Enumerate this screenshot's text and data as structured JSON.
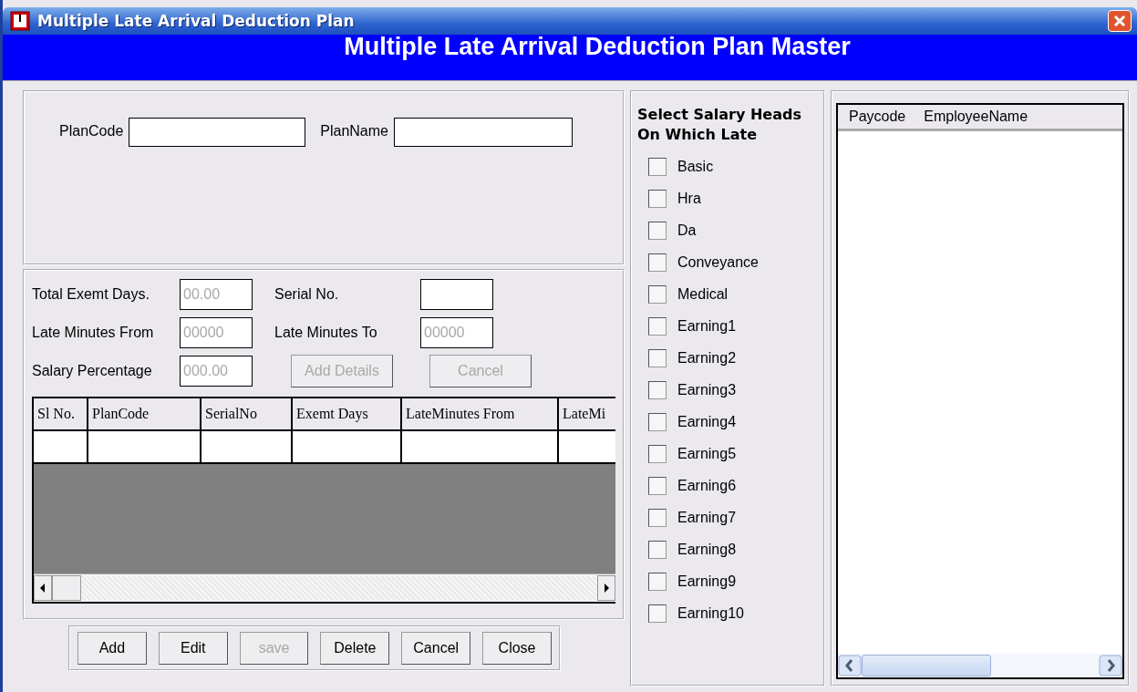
{
  "window": {
    "title": "Multiple Late Arrival Deduction Plan"
  },
  "header": "Multiple Late Arrival Deduction Plan Master",
  "plan": {
    "code_label": "PlanCode",
    "name_label": "PlanName"
  },
  "details": {
    "fields": [
      {
        "label": "Total Exemt Days.",
        "placeholder": "00.00"
      },
      {
        "label": "Serial No."
      },
      {
        "label": "Late Minutes From",
        "placeholder": "00000"
      },
      {
        "label": "Late Minutes To",
        "placeholder": "00000"
      },
      {
        "label": "Salary Percentage",
        "placeholder": "000.00"
      }
    ],
    "buttons": [
      {
        "label": "Add Details",
        "disabled": true
      },
      {
        "label": "Cancel",
        "disabled": true
      }
    ]
  },
  "grid": {
    "columns": [
      "Sl No.",
      "PlanCode",
      "SerialNo",
      "Exemt Days",
      "LateMinutes From",
      "LateMi"
    ]
  },
  "actions": [
    {
      "label": "Add",
      "disabled": false
    },
    {
      "label": "Edit",
      "disabled": false
    },
    {
      "label": "save",
      "disabled": true
    },
    {
      "label": "Delete",
      "disabled": false
    },
    {
      "label": "Cancel",
      "disabled": false
    },
    {
      "label": "Close",
      "disabled": false
    }
  ],
  "salary_heads": {
    "title": "Select Salary Heads On Which Late",
    "items": [
      {
        "label": "Basic",
        "checked": false
      },
      {
        "label": "Hra",
        "checked": false
      },
      {
        "label": "Da",
        "checked": false
      },
      {
        "label": "Conveyance",
        "checked": false
      },
      {
        "label": "Medical",
        "checked": false
      },
      {
        "label": "Earning1",
        "checked": false
      },
      {
        "label": "Earning2",
        "checked": false
      },
      {
        "label": "Earning3",
        "checked": false
      },
      {
        "label": "Earning4",
        "checked": false
      },
      {
        "label": "Earning5",
        "checked": false
      },
      {
        "label": "Earning6",
        "checked": false
      },
      {
        "label": "Earning7",
        "checked": false
      },
      {
        "label": "Earning8",
        "checked": false
      },
      {
        "label": "Earning9",
        "checked": false
      },
      {
        "label": "Earning10",
        "checked": false
      }
    ]
  },
  "employees": {
    "columns": [
      "Paycode",
      "EmployeeName"
    ]
  }
}
